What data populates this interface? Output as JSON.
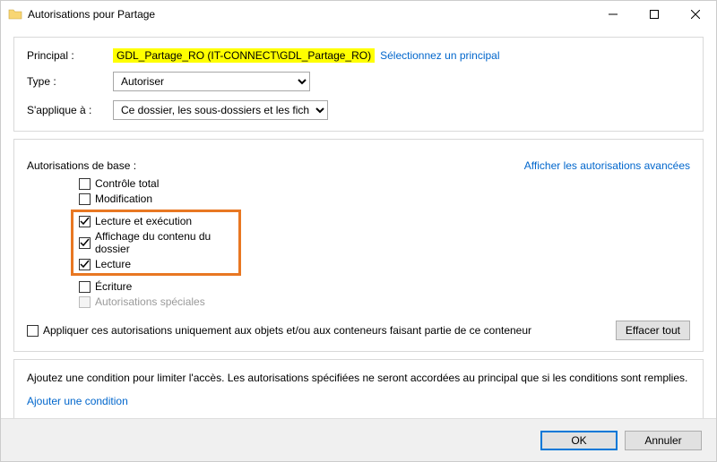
{
  "window": {
    "title": "Autorisations pour Partage"
  },
  "principal": {
    "label": "Principal :",
    "value": "GDL_Partage_RO (IT-CONNECT\\GDL_Partage_RO)",
    "select_link": "Sélectionnez un principal"
  },
  "type": {
    "label": "Type :",
    "value": "Autoriser"
  },
  "applies": {
    "label": "S'applique à :",
    "value": "Ce dossier, les sous-dossiers et les fichiers"
  },
  "permissions": {
    "label": "Autorisations de base :",
    "advanced_link": "Afficher les autorisations avancées",
    "items": {
      "full": "Contrôle total",
      "modify": "Modification",
      "read_exec": "Lecture et exécution",
      "list_folder": "Affichage du contenu du dossier",
      "read": "Lecture",
      "write": "Écriture",
      "special": "Autorisations spéciales"
    }
  },
  "apply_only": {
    "label": "Appliquer ces autorisations uniquement aux objets et/ou aux conteneurs faisant partie de ce conteneur",
    "clear_btn": "Effacer tout"
  },
  "condition": {
    "desc": "Ajoutez une condition pour limiter l'accès. Les autorisations spécifiées ne seront accordées au principal que si les conditions sont remplies.",
    "add_link": "Ajouter une condition"
  },
  "footer": {
    "ok": "OK",
    "cancel": "Annuler"
  }
}
